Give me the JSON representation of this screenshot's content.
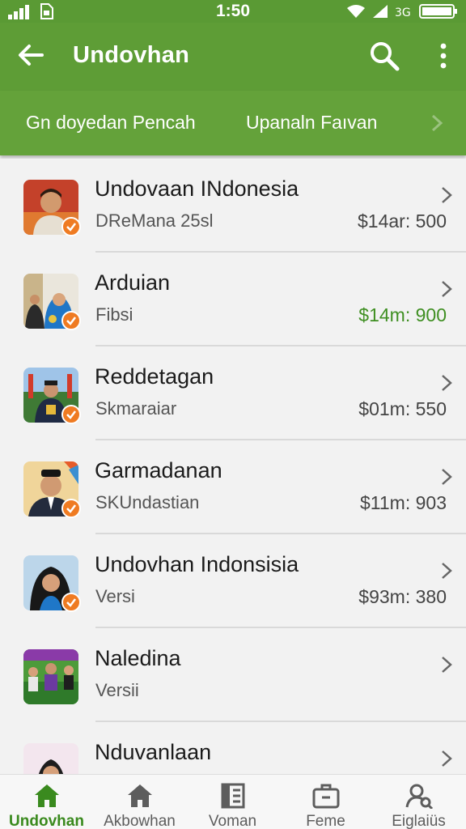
{
  "status_bar": {
    "time": "1:50"
  },
  "app_bar": {
    "title": "Undovhan"
  },
  "tabs": [
    {
      "label": "Gn doyedan Pencah"
    },
    {
      "label": "Upanaln Faıvan"
    }
  ],
  "items": [
    {
      "name": "Undovaan INdonesia",
      "sub": "DReMana 25sl",
      "price": "$14ar: 500",
      "price_color": "#444444"
    },
    {
      "name": "Arduian",
      "sub": "Fibsi",
      "price": "$14m: 900",
      "price_color": "#3f8f22"
    },
    {
      "name": "Reddetagan",
      "sub": "Skmaraiar",
      "price": "$01m: 550",
      "price_color": "#444444"
    },
    {
      "name": "Garmadanan",
      "sub": "SKUndastian",
      "price": "$11m: 903",
      "price_color": "#444444"
    },
    {
      "name": "Undovhan Indonsisia",
      "sub": "Versi",
      "price": "$93m: 380",
      "price_color": "#444444"
    },
    {
      "name": "Naledina",
      "sub": "Versii",
      "price": "",
      "price_color": "#444444"
    },
    {
      "name": "Nduvanlaan",
      "sub": "",
      "price": "",
      "price_color": "#444444"
    }
  ],
  "bottom_nav": [
    {
      "label": "Undovhan",
      "icon": "home-icon",
      "active": true
    },
    {
      "label": "Akbowhan",
      "icon": "home-icon",
      "active": false
    },
    {
      "label": "Voman",
      "icon": "document-icon",
      "active": false
    },
    {
      "label": "Feme",
      "icon": "briefcase-icon",
      "active": false
    },
    {
      "label": "Eiglaiüs",
      "icon": "person-search-icon",
      "active": false
    }
  ],
  "colors": {
    "primary": "#5e9d36",
    "accent_badge": "#ef7b22",
    "price_green": "#3f8f22",
    "nav_active": "#3a8a1e"
  }
}
